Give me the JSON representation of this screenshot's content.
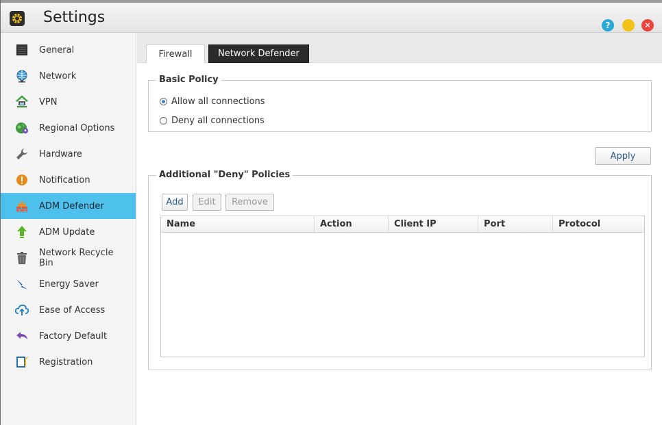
{
  "window": {
    "title": "Settings",
    "help_label": "?",
    "minimize_label": "−",
    "close_label": "✕"
  },
  "sidebar": {
    "items": [
      {
        "label": "General",
        "icon": "server-icon",
        "active": false
      },
      {
        "label": "Network",
        "icon": "globe-icon",
        "active": false
      },
      {
        "label": "VPN",
        "icon": "vpn-house-icon",
        "active": false
      },
      {
        "label": "Regional Options",
        "icon": "globe-location-icon",
        "active": false
      },
      {
        "label": "Hardware",
        "icon": "wrench-icon",
        "active": false
      },
      {
        "label": "Notification",
        "icon": "exclamation-icon",
        "active": false
      },
      {
        "label": "ADM Defender",
        "icon": "firewall-icon",
        "active": true
      },
      {
        "label": "ADM Update",
        "icon": "arrow-up-icon",
        "active": false
      },
      {
        "label": "Network Recycle Bin",
        "icon": "trash-icon",
        "active": false
      },
      {
        "label": "Energy Saver",
        "icon": "lightning-icon",
        "active": false
      },
      {
        "label": "Ease of Access",
        "icon": "cloud-upload-icon",
        "active": false
      },
      {
        "label": "Factory Default",
        "icon": "undo-arrow-icon",
        "active": false
      },
      {
        "label": "Registration",
        "icon": "clipboard-icon",
        "active": false
      }
    ]
  },
  "tabs": [
    {
      "label": "Firewall",
      "selected": false
    },
    {
      "label": "Network Defender",
      "selected": true
    }
  ],
  "basic_policy": {
    "legend": "Basic Policy",
    "options": [
      {
        "label": "Allow all connections",
        "checked": true
      },
      {
        "label": "Deny all connections",
        "checked": false
      }
    ]
  },
  "apply_label": "Apply",
  "deny_policies": {
    "legend": "Additional \"Deny\" Policies",
    "add_label": "Add",
    "edit_label": "Edit",
    "remove_label": "Remove",
    "columns": [
      "Name",
      "Action",
      "Client IP",
      "Port",
      "Protocol"
    ],
    "rows": []
  },
  "colors": {
    "accent": "#4ec0ec",
    "active_tab": "#2b2b2b",
    "help": "#2aa8d8",
    "minimize": "#f2c21a",
    "close": "#e8453c"
  }
}
